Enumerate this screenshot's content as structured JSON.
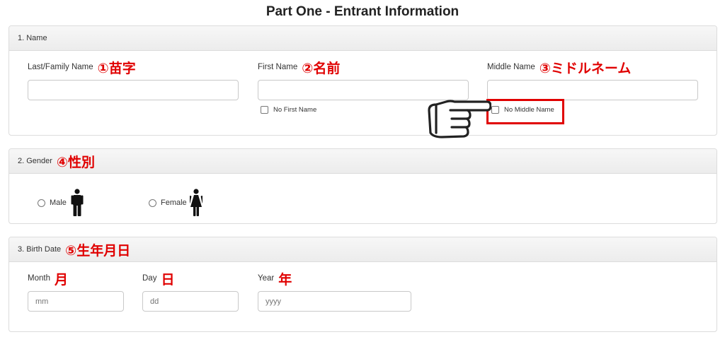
{
  "page": {
    "title": "Part One - Entrant Information"
  },
  "name_section": {
    "title": "1. Name",
    "last": {
      "label": "Last/Family Name",
      "ja": "①苗字",
      "value": ""
    },
    "first": {
      "label": "First Name",
      "ja": "②名前",
      "value": "",
      "no_label": "No First Name"
    },
    "middle": {
      "label": "Middle Name",
      "ja": "③ミドルネーム",
      "value": "",
      "no_label": "No Middle Name"
    }
  },
  "gender_section": {
    "title": "2. Gender",
    "ja": "④性別",
    "male_label": "Male",
    "female_label": "Female"
  },
  "birth_section": {
    "title": "3. Birth Date",
    "ja": "⑤生年月日",
    "month": {
      "label": "Month",
      "ja": "月",
      "placeholder": "mm"
    },
    "day": {
      "label": "Day",
      "ja": "日",
      "placeholder": "dd"
    },
    "year": {
      "label": "Year",
      "ja": "年",
      "placeholder": "yyyy"
    }
  },
  "icons": {
    "pointer": "pointing-hand-icon",
    "male": "male-figure-icon",
    "female": "female-figure-icon"
  },
  "colors": {
    "annotation_red": "#e00000",
    "panel_border": "#dcdcdc"
  }
}
